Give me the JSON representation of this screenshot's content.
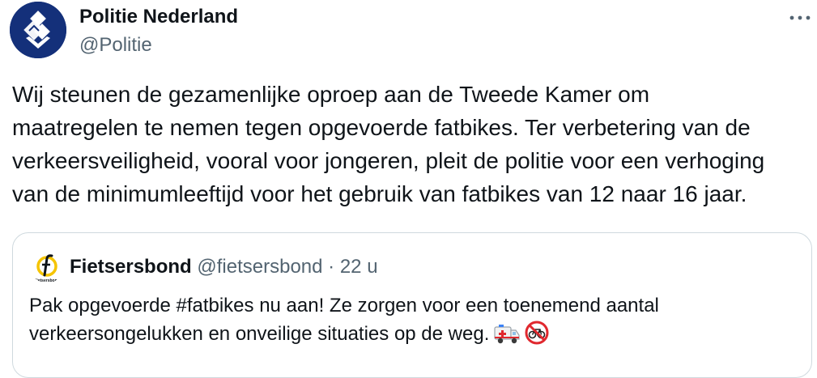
{
  "tweet": {
    "author": {
      "display_name": "Politie Nederland",
      "handle": "@Politie",
      "avatar_icon": "politie-logo-icon"
    },
    "more_icon": "more-horizontal-icon",
    "text": "Wij steunen de gezamenlijke oproep aan de Tweede Kamer om\nmaatregelen te nemen tegen opgevoerde fatbikes. Ter verbetering van de\nverkeersveiligheid, vooral voor jongeren, pleit de politie voor een verhoging\nvan de minimumleeftijd voor het gebruik van fatbikes van 12 naar 16 jaar."
  },
  "quote": {
    "author": {
      "display_name": "Fietsersbond",
      "handle": "@fietsersbond",
      "separator": "·",
      "time": "22 u",
      "avatar_icon": "fietsersbond-logo-icon",
      "avatar_text": "Fietsersbond"
    },
    "text": "Pak opgevoerde #fatbikes nu aan! Ze zorgen voor een toenemend aantal\nverkeersongelukken en onveilige situaties op de weg.",
    "emojis": [
      "ambulance-emoji",
      "no-bicycles-emoji"
    ]
  },
  "colors": {
    "text_primary": "#0f1419",
    "text_secondary": "#536471",
    "border": "#cfd9de",
    "politie_blue": "#14307a",
    "fietsersbond_yellow": "#f5c400"
  }
}
